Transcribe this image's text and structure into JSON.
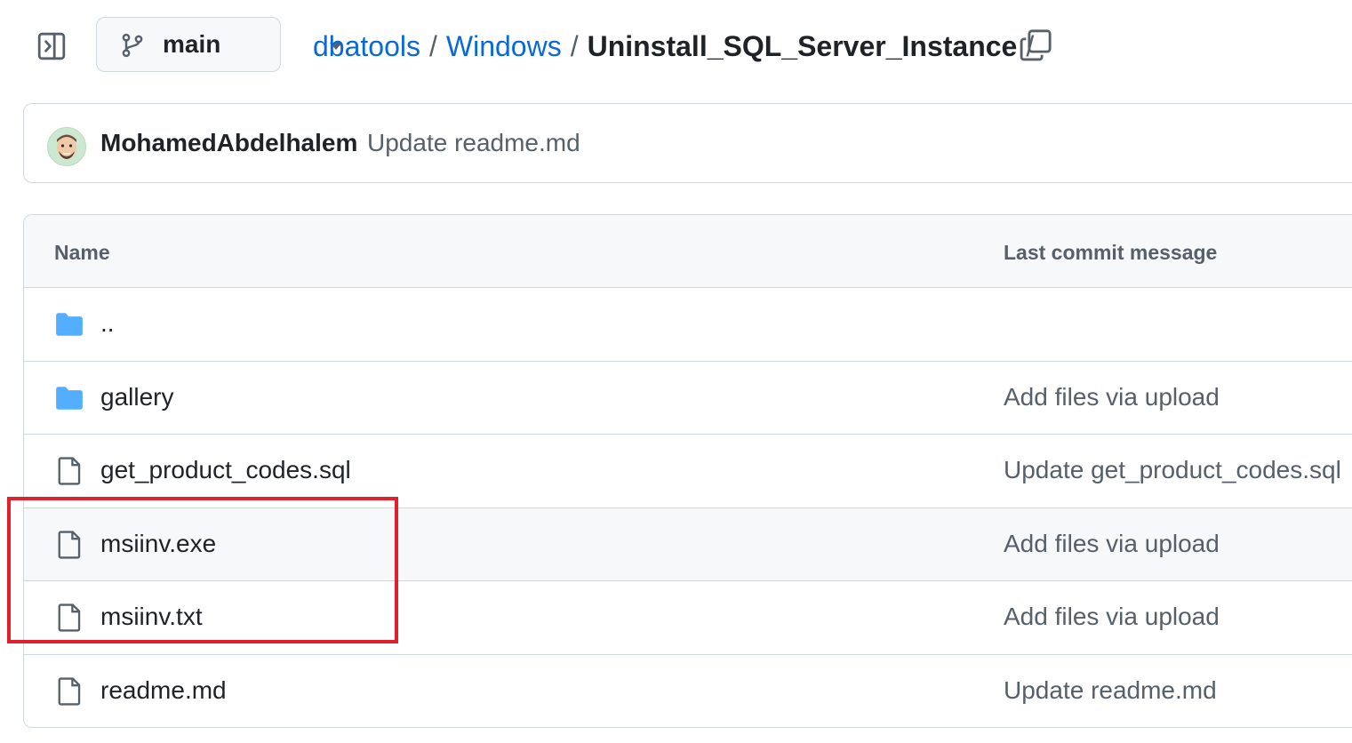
{
  "toolbar": {
    "sidebar_toggle_icon": "sidebar-expand-icon",
    "branch": {
      "icon": "git-branch-icon",
      "label": "main",
      "caret_icon": "triangle-down-icon"
    }
  },
  "breadcrumb": {
    "items": [
      "dbatools",
      "Windows"
    ],
    "separator": "/",
    "current": "Uninstall_SQL_Server_Instance",
    "trailing_separator": "/",
    "copy_icon": "copy-icon"
  },
  "latest_commit": {
    "avatar_icon": "avatar-icon",
    "author": "MohamedAbdelhalem",
    "message": "Update readme.md"
  },
  "file_table": {
    "columns": {
      "name": "Name",
      "last_commit_message": "Last commit message"
    },
    "rows": [
      {
        "type": "folder",
        "icon": "folder-icon",
        "name": "..",
        "message": ""
      },
      {
        "type": "folder",
        "icon": "folder-icon",
        "name": "gallery",
        "message": "Add files via upload"
      },
      {
        "type": "file",
        "icon": "file-icon",
        "name": "get_product_codes.sql",
        "message": "Update get_product_codes.sql"
      },
      {
        "type": "file",
        "icon": "file-icon",
        "name": "msiinv.exe",
        "message": "Add files via upload"
      },
      {
        "type": "file",
        "icon": "file-icon",
        "name": "msiinv.txt",
        "message": "Add files via upload"
      },
      {
        "type": "file",
        "icon": "file-icon",
        "name": "readme.md",
        "message": "Update readme.md"
      }
    ]
  },
  "colors": {
    "link": "#0969da",
    "text": "#1f2328",
    "muted": "#57606a",
    "folder": "#54aeff",
    "border": "#d0d7de",
    "highlight": "#e0202a"
  }
}
